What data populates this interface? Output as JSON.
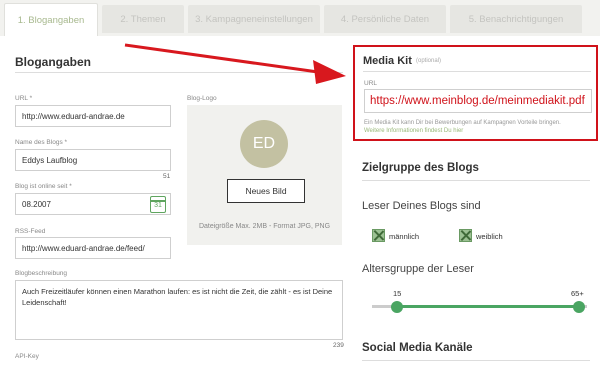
{
  "tabs": [
    {
      "label": "1. Blogangaben",
      "active": true
    },
    {
      "label": "2. Themen",
      "active": false
    },
    {
      "label": "3. Kampagneneinstellungen",
      "active": false
    },
    {
      "label": "4. Persönliche Daten",
      "active": false
    },
    {
      "label": "5. Benachrichtigungen",
      "active": false
    }
  ],
  "blog": {
    "title": "Blogangaben",
    "url_label": "URL *",
    "url_value": "http://www.eduard-andrae.de",
    "name_label": "Name des Blogs *",
    "name_value": "Eddys Laufblog",
    "name_counter": "51",
    "online_label": "Blog ist online seit *",
    "online_value": "08.2007",
    "calendar_day": "31",
    "rss_label": "RSS-Feed",
    "rss_value": "http://www.eduard-andrae.de/feed/",
    "desc_label": "Blogbeschreibung",
    "desc_value": "Auch Freizeitläufer können einen Marathon laufen: es ist nicht die Zeit, die zählt - es ist Deine Leidenschaft!",
    "desc_counter": "239",
    "api_label": "API-Key"
  },
  "logo": {
    "label": "Blog-Logo",
    "initials": "ED",
    "button": "Neues Bild",
    "hint": "Dateigröße Max. 2MB - Format JPG, PNG"
  },
  "mediakit": {
    "title": "Media Kit",
    "optional": "(optional)",
    "url_label": "URL",
    "url_value": "https://www.meinblog.de/meinmediakit.pdf",
    "hint": "Ein Media Kit kann Dir bei Bewerbungen auf Kampagnen Vorteile bringen.",
    "link": "Weitere Informationen findest Du hier"
  },
  "audience": {
    "title": "Zielgruppe des Blogs",
    "readers_title": "Leser Deines Blogs sind",
    "male": "männlich",
    "female": "weiblich",
    "age_title": "Altersgruppe der Leser",
    "age_min": "15",
    "age_max": "65+"
  },
  "social": {
    "title": "Social Media Kanäle"
  },
  "colors": {
    "accent": "#d0121a",
    "green": "#4aa562",
    "avatar": "#c3c1a2"
  }
}
